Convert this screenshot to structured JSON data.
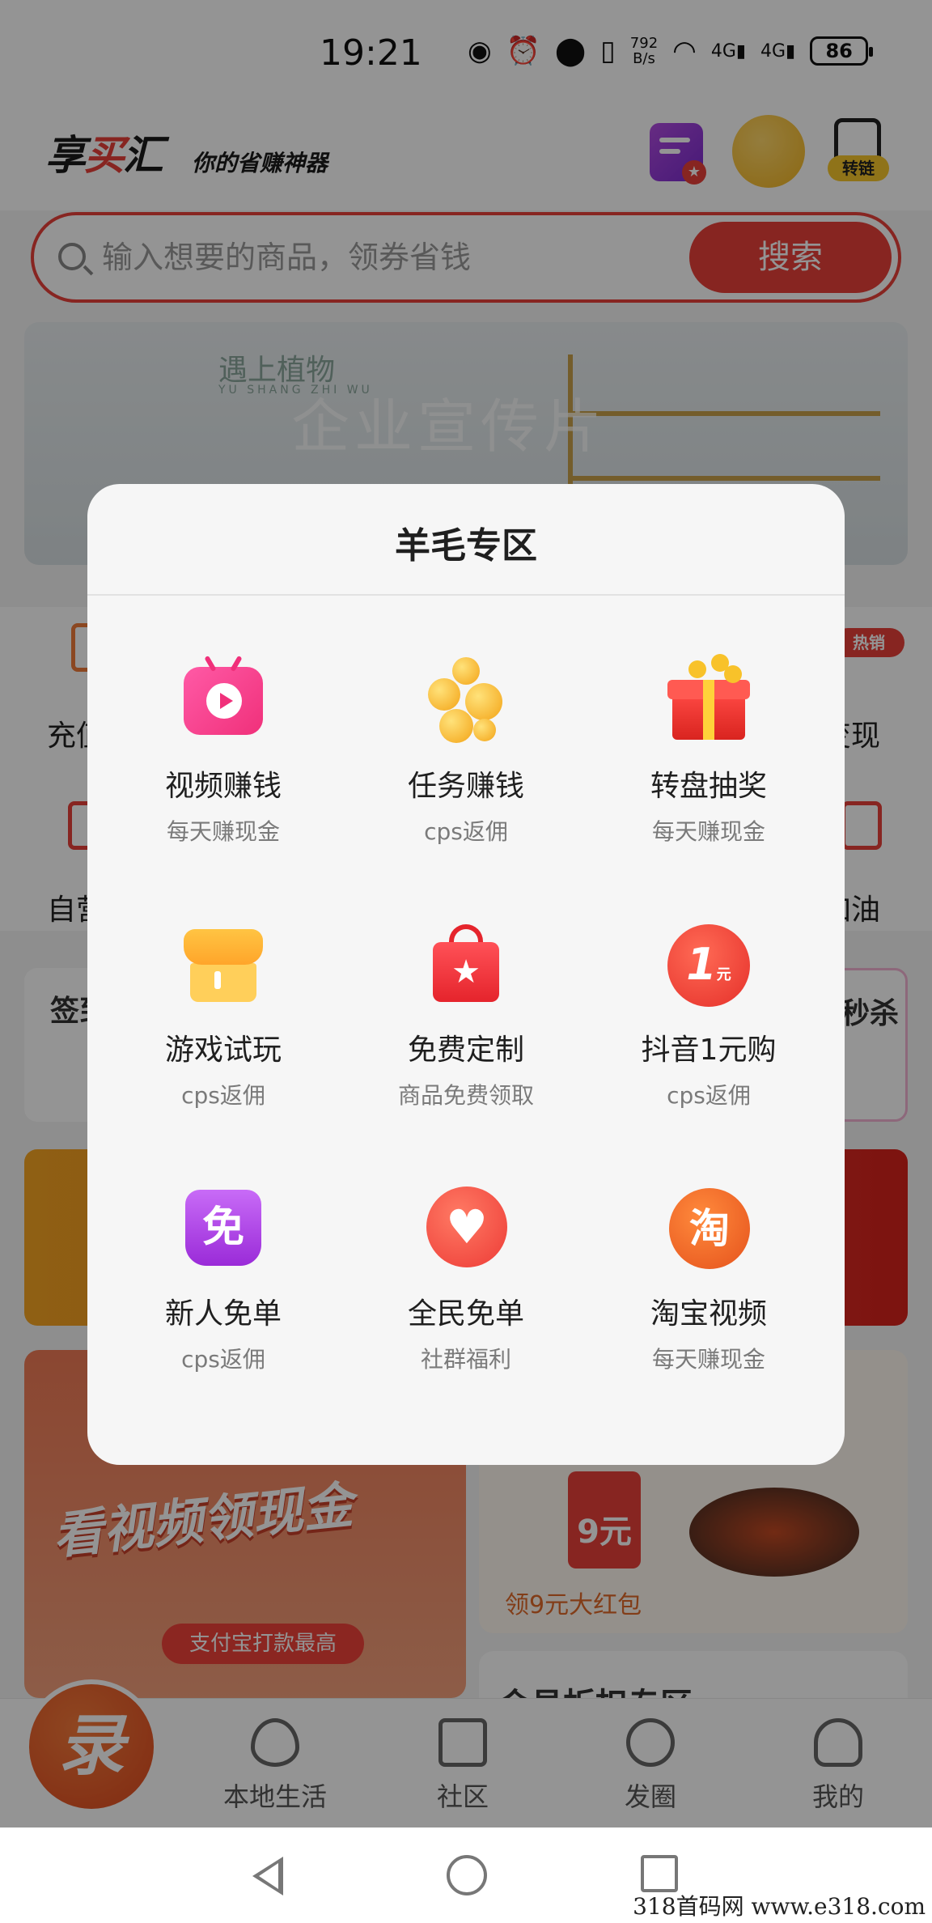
{
  "status_bar": {
    "time": "19:21",
    "net_speed_value": "792",
    "net_speed_unit": "B/s",
    "signal_1": "4G",
    "signal_2": "4G",
    "battery": "86"
  },
  "header": {
    "logo_part1": "享",
    "logo_part2": "买",
    "logo_part3": "汇",
    "slogan": "你的省赚神器",
    "convert_link_label": "转链"
  },
  "search": {
    "placeholder": "输入想要的商品，领券省钱",
    "button_label": "搜索"
  },
  "banner": {
    "brand": "遇上植物",
    "brand_sub": "YU SHANG ZHI WU",
    "title": "企业宣传片"
  },
  "background": {
    "grid_labels": [
      "充值",
      "变现",
      "自营",
      "加油"
    ],
    "hot_tag": "热销",
    "card_left_title": "签到",
    "card_right_title": "秒杀",
    "promo_left_title": "看视频领现金",
    "promo_left_pill": "支付宝打款最高",
    "red_envelope_amount": "9元",
    "promo_right_label": "领9元大红包",
    "promo_right2_title": "会员折扣专区"
  },
  "modal": {
    "title": "羊毛专区",
    "tiles": [
      {
        "name": "视频赚钱",
        "sub": "每天赚现金",
        "icon": "video-tv-icon"
      },
      {
        "name": "任务赚钱",
        "sub": "cps返佣",
        "icon": "gold-coins-icon"
      },
      {
        "name": "转盘抽奖",
        "sub": "每天赚现金",
        "icon": "gift-box-icon"
      },
      {
        "name": "游戏试玩",
        "sub": "cps返佣",
        "icon": "shop-store-icon"
      },
      {
        "name": "免费定制",
        "sub": "商品免费领取",
        "icon": "shopping-bag-icon"
      },
      {
        "name": "抖音1元购",
        "sub": "cps返佣",
        "icon": "one-yuan-icon",
        "icon_text": "1",
        "icon_unit": "元"
      },
      {
        "name": "新人免单",
        "sub": "cps返佣",
        "icon": "free-badge-icon",
        "icon_text": "免"
      },
      {
        "name": "全民免单",
        "sub": "社群福利",
        "icon": "heart-icon"
      },
      {
        "name": "淘宝视频",
        "sub": "每天赚现金",
        "icon": "taobao-icon",
        "icon_text": "淘"
      }
    ]
  },
  "bottom_nav": {
    "fab_glyph": "录",
    "items": [
      {
        "label": "本地生活",
        "icon": "flame-icon"
      },
      {
        "label": "社区",
        "icon": "graduation-cap-icon"
      },
      {
        "label": "发圈",
        "icon": "circle-arrow-icon"
      },
      {
        "label": "我的",
        "icon": "user-icon"
      }
    ]
  },
  "watermark": "318首码网  www.e318.com",
  "colors": {
    "brand_red": "#e8413a",
    "overlay": "rgba(0,0,0,0.42)",
    "modal_bg": "#f6f6f6"
  }
}
